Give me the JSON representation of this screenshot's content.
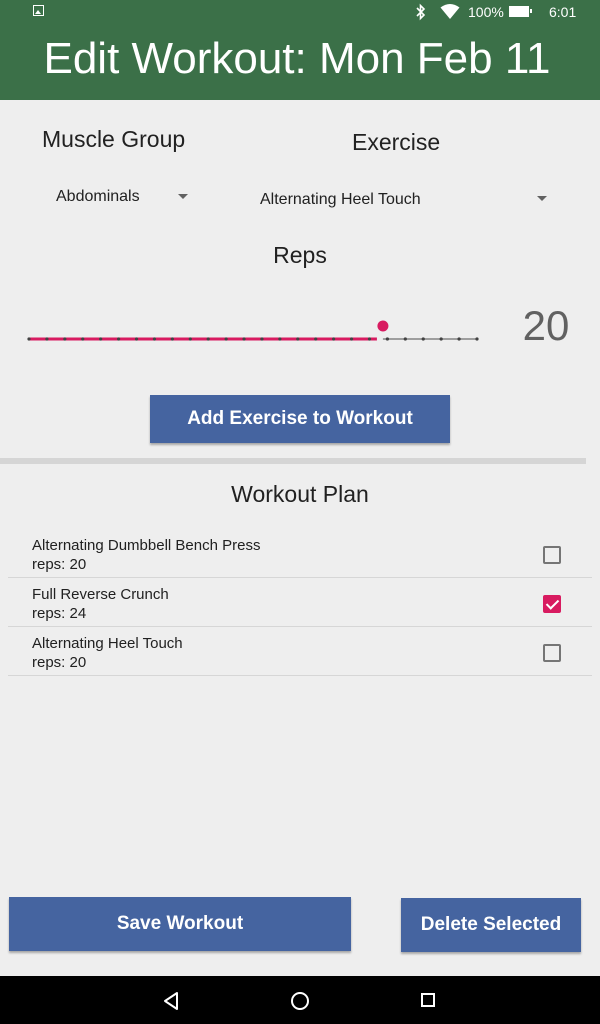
{
  "status_bar": {
    "battery": "100%",
    "time": "6:01",
    "icons": [
      "gallery-notification-icon",
      "bluetooth-icon",
      "wifi-icon",
      "battery-icon"
    ]
  },
  "app_bar": {
    "title": "Edit Workout: Mon Feb 11"
  },
  "form": {
    "muscle_group_label": "Muscle Group",
    "muscle_group_value": "Abdominals",
    "exercise_label": "Exercise",
    "exercise_value": "Alternating Heel Touch",
    "reps_label": "Reps",
    "reps_value": "20",
    "reps_slider_fraction": 0.79,
    "add_button": "Add Exercise to Workout"
  },
  "plan": {
    "title": "Workout Plan",
    "items": [
      {
        "name": "Alternating Dumbbell Bench Press",
        "reps": "reps: 20",
        "checked": false
      },
      {
        "name": "Full Reverse Crunch",
        "reps": "reps: 24",
        "checked": true
      },
      {
        "name": "Alternating Heel Touch",
        "reps": "reps: 20",
        "checked": false
      }
    ]
  },
  "actions": {
    "save": "Save Workout",
    "delete": "Delete Selected"
  },
  "colors": {
    "app_bar": "#3b7048",
    "button": "#4564a0",
    "accent": "#d81b60"
  },
  "nav_bar": {
    "icons": [
      "back-icon",
      "home-icon",
      "recents-icon"
    ]
  }
}
